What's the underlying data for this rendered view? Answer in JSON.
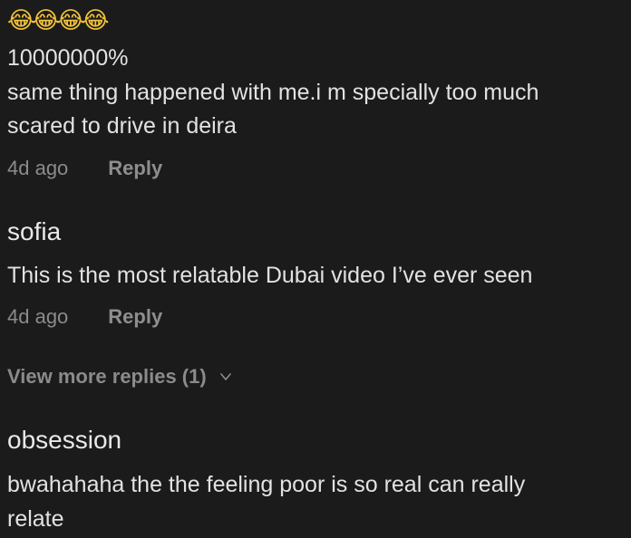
{
  "comments": [
    {
      "emoji": "😂😂😂😂",
      "lines": [
        "10000000%",
        "same thing happened with me.i m specially too much",
        "scared to drive in deira"
      ],
      "time": "4d ago",
      "reply_label": "Reply"
    },
    {
      "username": "sofia",
      "text": "This is the most relatable Dubai video I’ve ever seen",
      "time": "4d ago",
      "reply_label": "Reply",
      "view_more_label": "View more replies (1)"
    },
    {
      "username": "obsession",
      "lines": [
        "bwahahaha the the feeling poor is so real can really",
        "relate"
      ]
    }
  ],
  "icons": {
    "view_more": "chevron-down-icon",
    "emoji": "tears-of-joy-emoji"
  }
}
